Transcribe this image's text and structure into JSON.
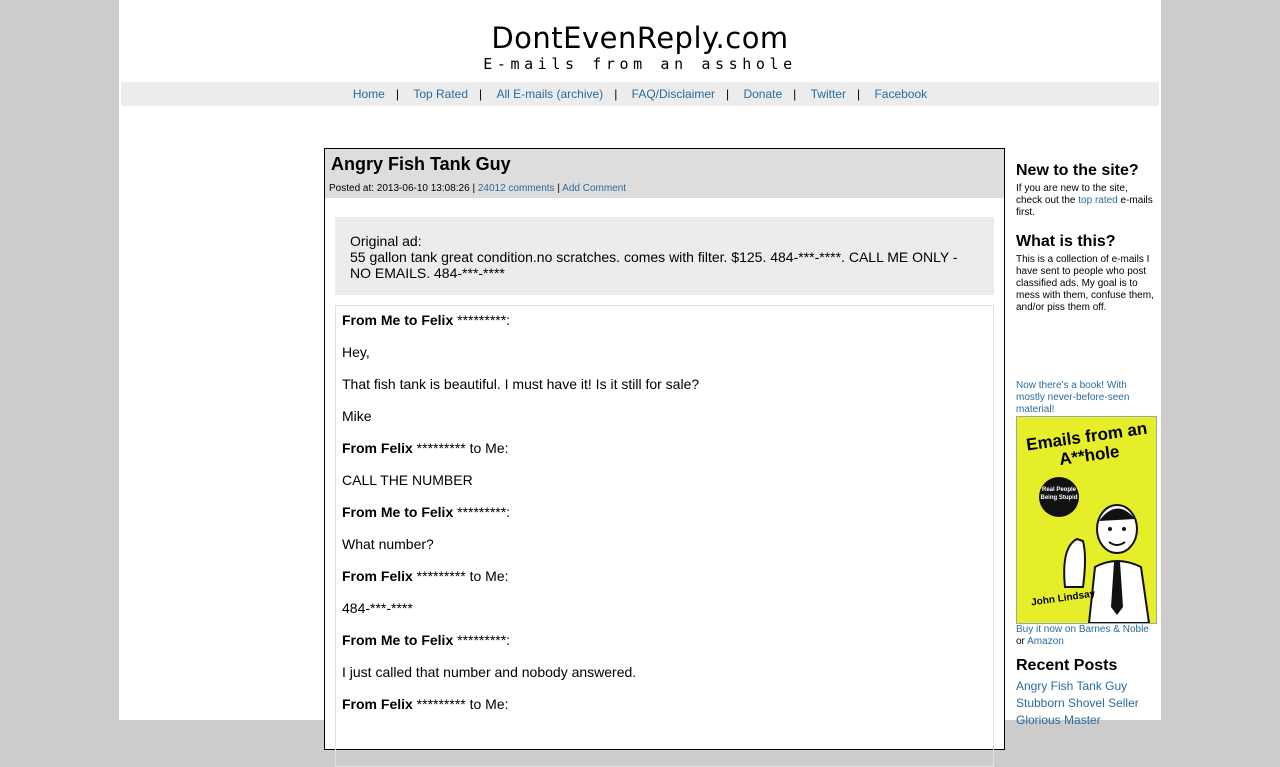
{
  "site": {
    "title": "DontEvenReply.com",
    "tagline": "E-mails from an asshole"
  },
  "nav": {
    "items": [
      {
        "label": "Home"
      },
      {
        "label": "Top Rated"
      },
      {
        "label": "All E-mails (archive)"
      },
      {
        "label": "FAQ/Disclaimer"
      },
      {
        "label": "Donate"
      },
      {
        "label": "Twitter"
      },
      {
        "label": "Facebook"
      }
    ],
    "separator": "|"
  },
  "post": {
    "title": "Angry Fish Tank Guy",
    "posted_prefix": "Posted at: 2013-06-10 13:08:26 |",
    "comments_link": "24012 comments",
    "meta_sep": "|",
    "add_comment": "Add Comment",
    "ad_label": "Original ad:",
    "ad_text": "55 gallon tank great condition.no scratches. comes with filter. $125. 484-***-****. CALL ME ONLY - NO EMAILS. 484-***-****",
    "conversation": [
      {
        "type": "header",
        "text": "From Me to Felix",
        "suffix": " *********:"
      },
      {
        "type": "text",
        "text": "Hey,"
      },
      {
        "type": "text",
        "text": "That fish tank is beautiful. I must have it! Is it still for sale?"
      },
      {
        "type": "text",
        "text": "Mike"
      },
      {
        "type": "header",
        "text": "From Felix",
        "suffix": " ********* to Me:"
      },
      {
        "type": "text",
        "text": "CALL THE NUMBER"
      },
      {
        "type": "header",
        "text": "From Me to Felix",
        "suffix": " *********:"
      },
      {
        "type": "text",
        "text": "What number?"
      },
      {
        "type": "header",
        "text": "From Felix",
        "suffix": " ********* to Me:"
      },
      {
        "type": "text",
        "text": "484-***-****"
      },
      {
        "type": "header",
        "text": "From Me to Felix",
        "suffix": " *********:"
      },
      {
        "type": "text",
        "text": "I just called that number and nobody answered."
      },
      {
        "type": "header",
        "text": "From Felix",
        "suffix": " ********* to Me:"
      }
    ]
  },
  "sidebar": {
    "new_heading": "New to the site?",
    "new_text_1": "If you are new to the site, check out the",
    "new_link": "top rated",
    "new_text_2": "e-mails first.",
    "what_heading": "What is this?",
    "what_text": "This is a collection of e-mails I have sent to people who post classified ads. My goal is to mess with them, confuse them, and/or piss them off.",
    "book_promo": "Now there's a book! With mostly never-before-seen material!",
    "book_cover_title": "Emails from an A**hole",
    "book_cover_badge": "Real People Being Stupid",
    "book_cover_author": "John Lindsay",
    "buy_text_1": "Buy it now on Barnes & Noble",
    "buy_or": "or",
    "buy_amazon": "Amazon",
    "recent_heading": "Recent Posts",
    "recent_posts": [
      "Angry Fish Tank Guy",
      "Stubborn Shovel Seller",
      "Glorious Master"
    ]
  },
  "colors": {
    "background": "#cccccc",
    "link": "#2a6b9c",
    "nav_bar": "#ececec",
    "post_header": "#dddddd",
    "book_yellow": "#e6ee2a"
  }
}
